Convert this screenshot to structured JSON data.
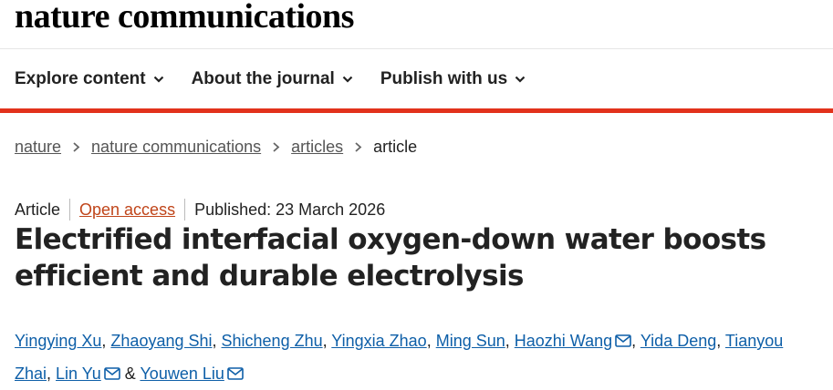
{
  "site": {
    "logo": "nature communications"
  },
  "nav": {
    "items": [
      "Explore content",
      "About the journal",
      "Publish with us"
    ]
  },
  "breadcrumb": {
    "links": [
      "nature",
      "nature communications",
      "articles"
    ],
    "current": "article"
  },
  "meta": {
    "type": "Article",
    "access": "Open access",
    "published": "Published: 23 March 2026"
  },
  "article": {
    "title": "Electrified interfacial oxygen-down water boosts efficient and durable electrolysis"
  },
  "authors": {
    "names": [
      "Yingying Xu",
      "Zhaoyang Shi",
      "Shicheng Zhu",
      "Yingxia Zhao",
      "Ming Sun",
      "Haozhi Wang",
      "Yida Deng",
      "Tianyou Zhai",
      "Lin Yu",
      "Youwen Liu"
    ],
    "separator": ", ",
    "final_separator": " & "
  },
  "colors": {
    "accent_red": "#e2321b",
    "link_blue": "#0e5fa8",
    "open_access": "#c0451a"
  },
  "icons": {
    "nav": "chevron-down-icon",
    "breadcrumb": "chevron-right-icon",
    "contact": "mail-icon"
  }
}
